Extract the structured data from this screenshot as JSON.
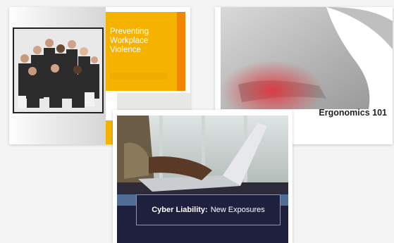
{
  "cards": [
    {
      "title": "Preventing Workplace Violence"
    },
    {
      "title": "Ergonomics 101"
    },
    {
      "title_bold": "Cyber Liability:",
      "title_rest": "New Exposures"
    }
  ]
}
